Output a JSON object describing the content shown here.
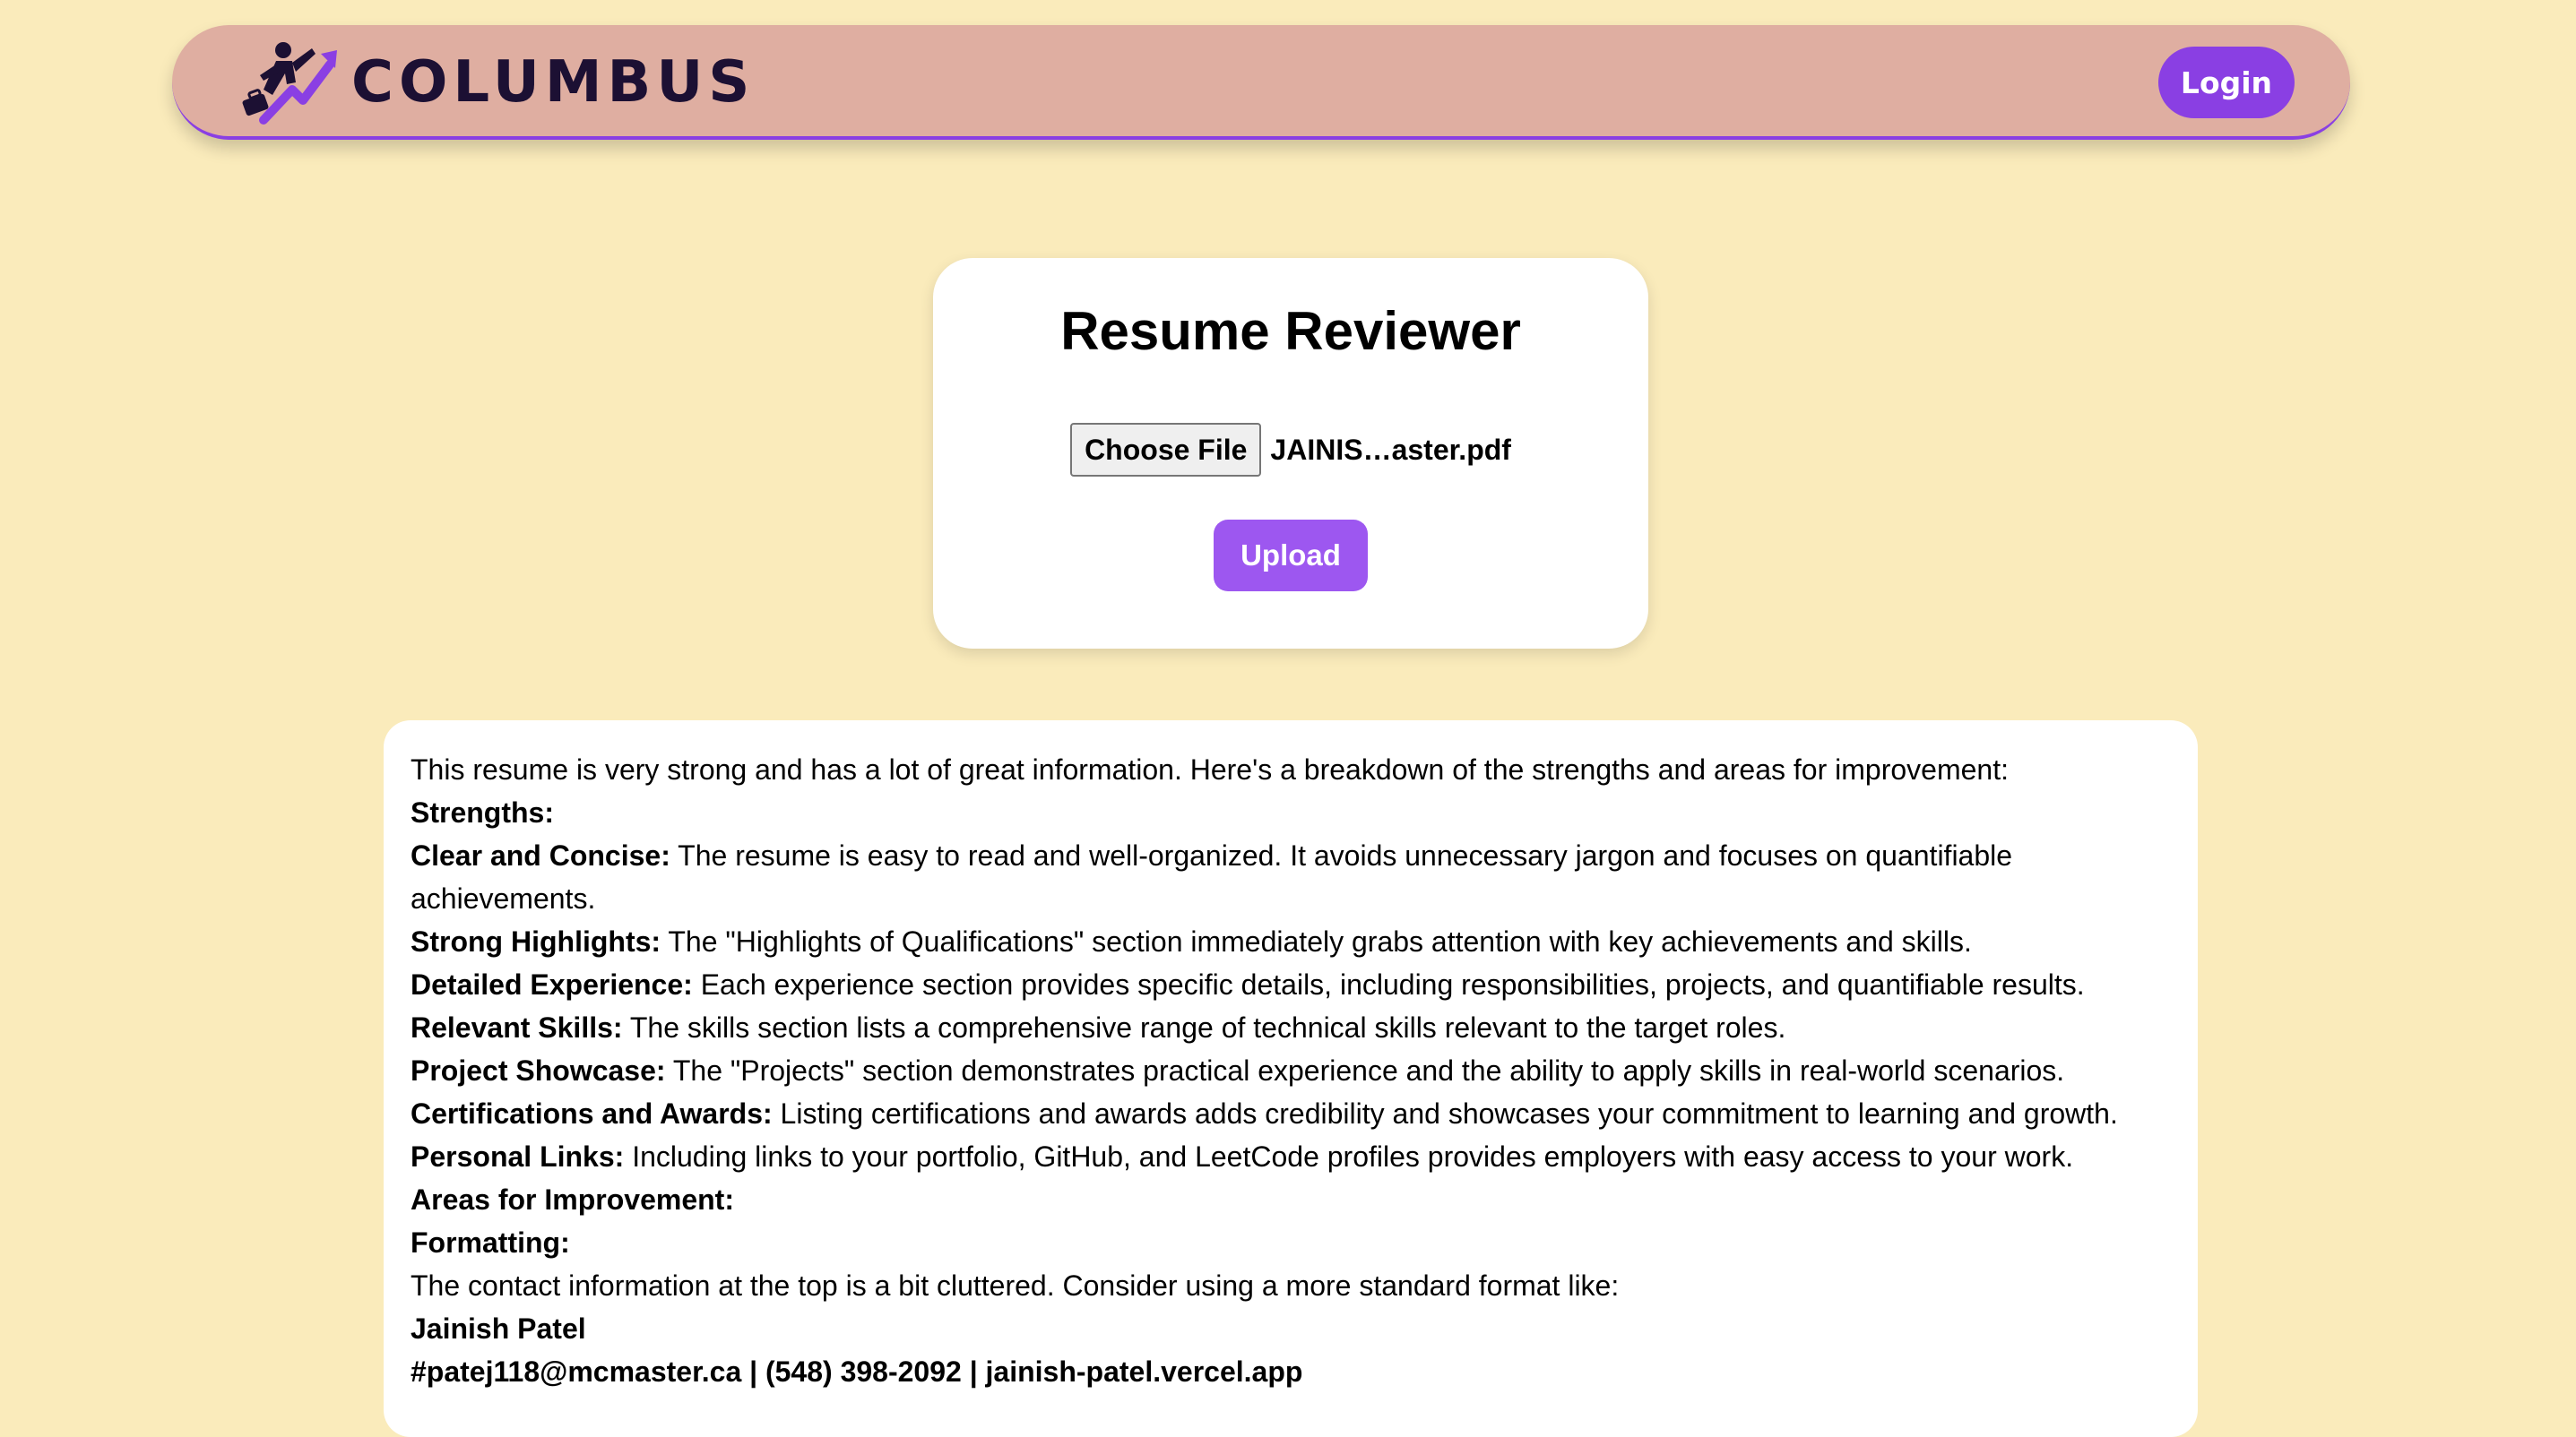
{
  "header": {
    "brand": "COLUMBUS",
    "logo_icon": "rocket-figure-icon",
    "login_label": "Login",
    "colors": {
      "page_background": "#FAEBBB",
      "navbar_background": "#DFAEA1",
      "accent": "#8A3FE3",
      "brand_text": "#1C1033"
    }
  },
  "upload": {
    "title": "Resume Reviewer",
    "choose_file_label": "Choose File",
    "file_name": "JAINIS…aster.pdf",
    "upload_label": "Upload",
    "upload_color": "#9D57F0"
  },
  "review": {
    "intro": "This resume is very strong and has a lot of great information. Here's a breakdown of the strengths and areas for improvement:",
    "strengths_heading": "Strengths:",
    "strengths": [
      {
        "title": "Clear and Concise:",
        "text": " The resume is easy to read and well-organized. It avoids unnecessary jargon and focuses on quantifiable achievements."
      },
      {
        "title": "Strong Highlights:",
        "text": " The \"Highlights of Qualifications\" section immediately grabs attention with key achievements and skills."
      },
      {
        "title": "Detailed Experience:",
        "text": " Each experience section provides specific details, including responsibilities, projects, and quantifiable results."
      },
      {
        "title": "Relevant Skills:",
        "text": " The skills section lists a comprehensive range of technical skills relevant to the target roles."
      },
      {
        "title": "Project Showcase:",
        "text": " The \"Projects\" section demonstrates practical experience and the ability to apply skills in real-world scenarios."
      },
      {
        "title": "Certifications and Awards:",
        "text": " Listing certifications and awards adds credibility and showcases your commitment to learning and growth."
      },
      {
        "title": "Personal Links:",
        "text": " Including links to your portfolio, GitHub, and LeetCode profiles provides employers with easy access to your work."
      }
    ],
    "improvement_heading": "Areas for Improvement:",
    "formatting_heading": "Formatting:",
    "formatting_text": "The contact information at the top is a bit cluttered. Consider using a more standard format like:",
    "contact_name": "Jainish Patel",
    "contact_line": "#patej118@mcmaster.ca | (548) 398-2092 | jainish-patel.vercel.app"
  }
}
